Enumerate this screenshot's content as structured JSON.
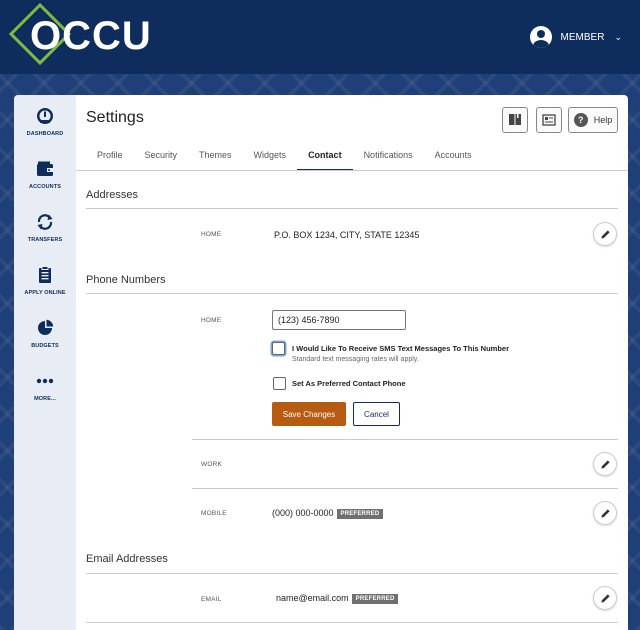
{
  "header": {
    "logo_text": "OCCU",
    "member_label": "MEMBER"
  },
  "sidebar": {
    "items": [
      {
        "label": "DASHBOARD",
        "icon": "speedometer-icon"
      },
      {
        "label": "ACCOUNTS",
        "icon": "wallet-icon"
      },
      {
        "label": "TRANSFERS",
        "icon": "transfer-arrows-icon"
      },
      {
        "label": "APPLY ONLINE",
        "icon": "clipboard-icon"
      },
      {
        "label": "BUDGETS",
        "icon": "pie-chart-icon"
      },
      {
        "label": "MORE...",
        "icon": "more-dots-icon"
      }
    ]
  },
  "page": {
    "title": "Settings",
    "help_label": "Help",
    "tabs": [
      {
        "label": "Profile",
        "active": false
      },
      {
        "label": "Security",
        "active": false
      },
      {
        "label": "Themes",
        "active": false
      },
      {
        "label": "Widgets",
        "active": false
      },
      {
        "label": "Contact",
        "active": true
      },
      {
        "label": "Notifications",
        "active": false
      },
      {
        "label": "Accounts",
        "active": false
      }
    ]
  },
  "addresses": {
    "heading": "Addresses",
    "home_label": "HOME",
    "home_value": "P.O. BOX 1234, CITY, STATE 12345"
  },
  "phones": {
    "heading": "Phone Numbers",
    "home_label": "HOME",
    "home_value": "(123) 456-7890",
    "sms_label": "I Would Like To Receive SMS Text Messages To This Number",
    "sms_sub": "Standard text messaging rates will apply.",
    "preferred_label": "Set As Preferred Contact Phone",
    "save_label": "Save Changes",
    "cancel_label": "Cancel",
    "work_label": "WORK",
    "mobile_label": "MOBILE",
    "mobile_value": "(000) 000-0000",
    "preferred_badge": "PREFERRED"
  },
  "emails": {
    "heading": "Email Addresses",
    "email_label": "EMAIL",
    "email_value": "name@email.com",
    "preferred_badge": "PREFERRED"
  },
  "colors": {
    "brand_navy": "#0e2c5c",
    "accent_green": "#7dbb41",
    "save_orange": "#b75a12"
  }
}
